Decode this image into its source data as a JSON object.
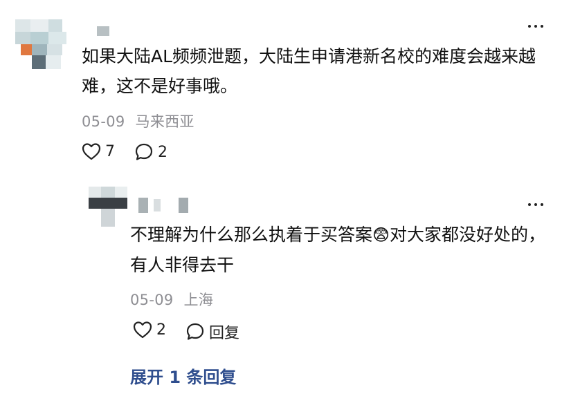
{
  "comments": [
    {
      "text": "如果大陆AL频频泄题，大陆生申请港新名校的难度会越来越难，这不是好事哦。",
      "date": "05-09",
      "location": "马来西亚",
      "likes": "7",
      "replies": "2",
      "more_icon": "ellipsis-icon"
    },
    {
      "text_before_emoji": "不理解为什么那么执着于买答案",
      "emoji": "😨",
      "text_after_emoji": "对大家都没好处的，有人非得去干",
      "date": "05-09",
      "location": "上海",
      "likes": "2",
      "reply_label": "回复",
      "more_icon": "ellipsis-icon"
    }
  ],
  "expand_replies_label": "展开 1 条回复",
  "colors": {
    "link": "#2f4e8e",
    "meta": "#8e8e93",
    "text": "#111111"
  }
}
